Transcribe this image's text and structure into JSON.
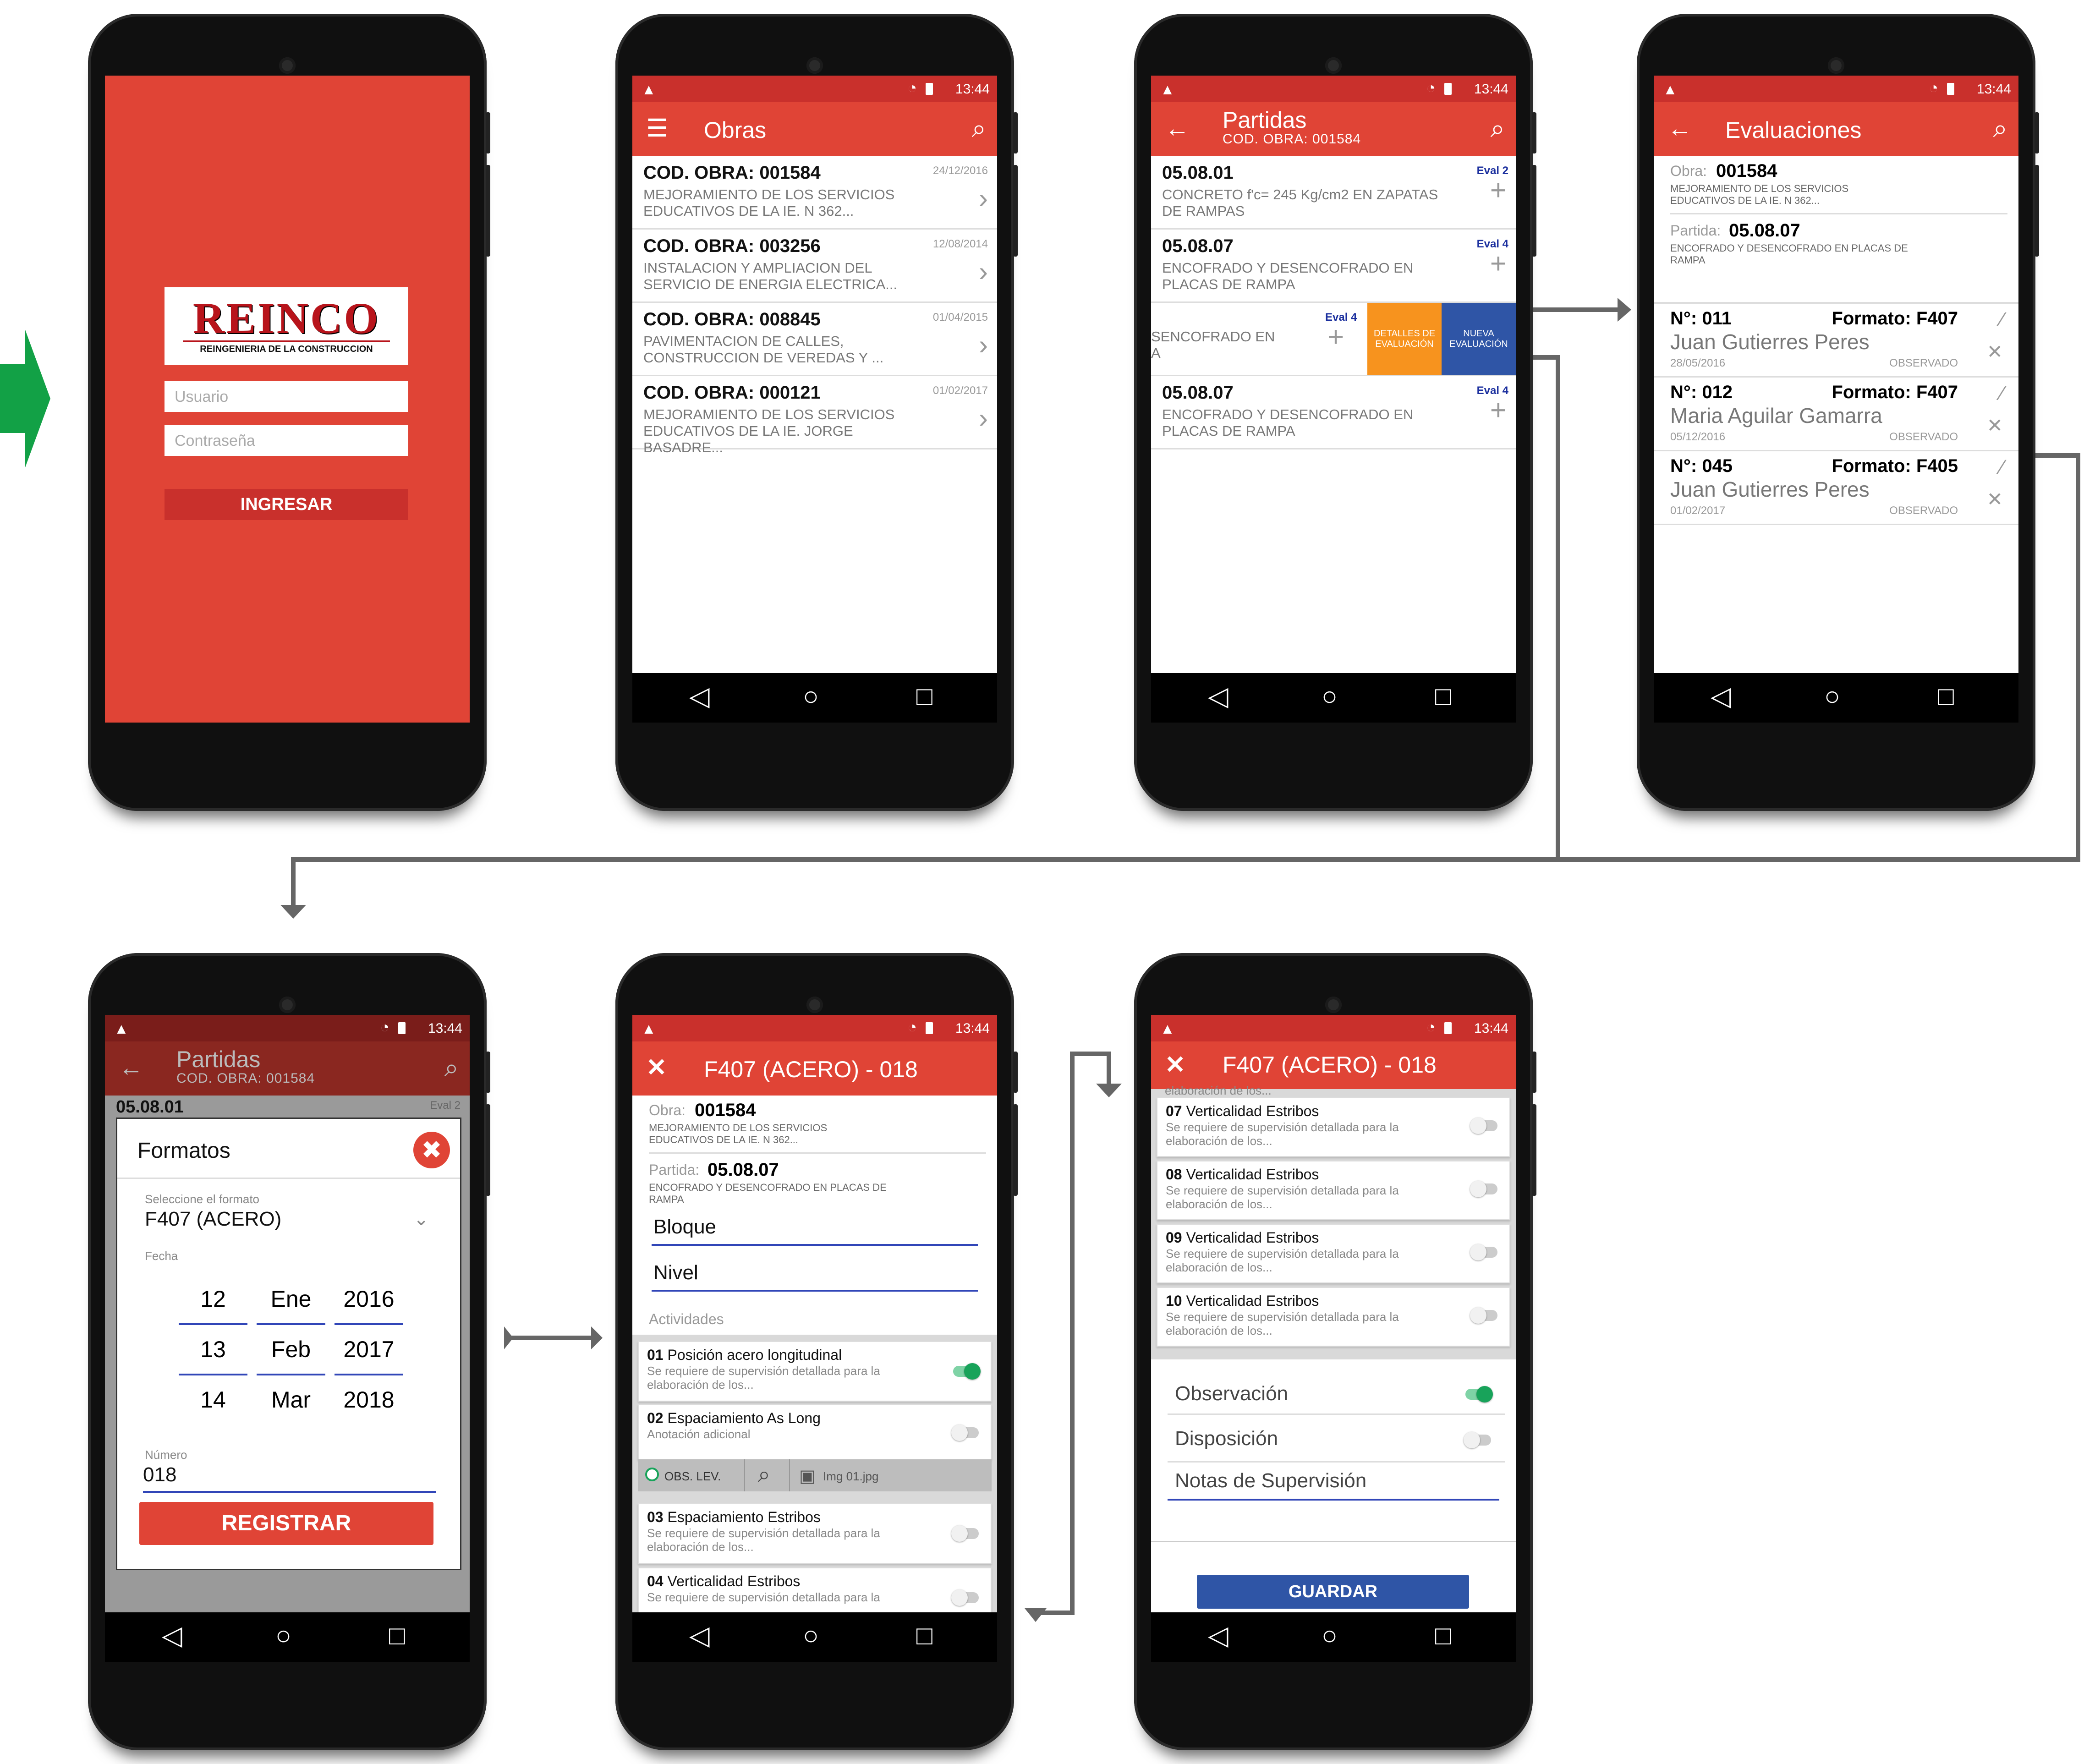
{
  "status": {
    "time": "13:44"
  },
  "login": {
    "logo_text": "REINCO",
    "logo_subtitle": "REINGENIERIA DE LA CONSTRUCCION",
    "user_placeholder": "Usuario",
    "password_placeholder": "Contraseña",
    "button": "INGRESAR"
  },
  "obras": {
    "title": "Obras",
    "items": [
      {
        "code": "COD. OBRA: 001584",
        "desc": "MEJORAMIENTO DE LOS SERVICIOS EDUCATIVOS DE LA IE. N 362...",
        "date": "24/12/2016"
      },
      {
        "code": "COD. OBRA: 003256",
        "desc": "INSTALACION Y AMPLIACION DEL SERVICIO DE ENERGIA ELECTRICA...",
        "date": "12/08/2014"
      },
      {
        "code": "COD. OBRA: 008845",
        "desc": "PAVIMENTACION DE CALLES, CONSTRUCCION DE VEREDAS Y ...",
        "date": "01/04/2015"
      },
      {
        "code": "COD. OBRA: 000121",
        "desc": "MEJORAMIENTO DE LOS SERVICIOS EDUCATIVOS DE LA IE. JORGE BASADRE...",
        "date": "01/02/2017"
      }
    ]
  },
  "partidas": {
    "title": "Partidas",
    "subtitle": "COD. OBRA: 001584",
    "items": [
      {
        "code": "05.08.01",
        "desc": "CONCRETO f'c= 245 Kg/cm2 EN ZAPATAS DE RAMPAS",
        "eval": "Eval 2"
      },
      {
        "code": "05.08.07",
        "desc": "ENCOFRADO Y DESENCOFRADO EN PLACAS DE RAMPA",
        "eval": "Eval 4"
      },
      {
        "code": "05.08.07",
        "desc": "ENCOFRADO Y DESENCOFRADO EN PLACAS DE RAMPA",
        "eval": "Eval 4"
      }
    ],
    "swiped": {
      "desc": "SENCOFRADO EN",
      "desc2": "A",
      "eval": "Eval 4",
      "details": "DETALLES DE EVALUACIÓN",
      "new": "NUEVA EVALUACIÓN"
    }
  },
  "evaluaciones": {
    "title": "Evaluaciones",
    "obra_label": "Obra:",
    "obra_code": "001584",
    "obra_desc": "MEJORAMIENTO DE LOS SERVICIOS EDUCATIVOS DE LA IE. N 362...",
    "partida_label": "Partida:",
    "partida_code": "05.08.07",
    "partida_desc": "ENCOFRADO Y DESENCOFRADO EN PLACAS DE RAMPA",
    "items": [
      {
        "num": "N°: 011",
        "formato": "Formato: F407",
        "name": "Juan Gutierres Peres",
        "date": "28/05/2016",
        "state": "OBSERVADO"
      },
      {
        "num": "N°: 012",
        "formato": "Formato: F407",
        "name": "Maria Aguilar Gamarra",
        "date": "05/12/2016",
        "state": "OBSERVADO"
      },
      {
        "num": "N°: 045",
        "formato": "Formato: F405",
        "name": "Juan Gutierres Peres",
        "date": "01/02/2017",
        "state": "OBSERVADO"
      }
    ]
  },
  "formatos": {
    "bg_title": "Partidas",
    "bg_subtitle": "COD. OBRA: 001584",
    "bg_code": "05.08.01",
    "bg_eval": "Eval 2",
    "title": "Formatos",
    "select_label": "Seleccione el formato",
    "select_value": "F407 (ACERO)",
    "fecha_label": "Fecha",
    "days": [
      "12",
      "13",
      "14"
    ],
    "months": [
      "Ene",
      "Feb",
      "Mar"
    ],
    "years": [
      "2016",
      "2017",
      "2018"
    ],
    "numero_label": "Número",
    "numero_value": "018",
    "button": "REGISTRAR"
  },
  "form1": {
    "title": "F407 (ACERO) - 018",
    "obra_label": "Obra:",
    "obra_code": "001584",
    "obra_desc": "MEJORAMIENTO DE LOS SERVICIOS EDUCATIVOS DE LA IE. N 362...",
    "partida_label": "Partida:",
    "partida_code": "05.08.07",
    "partida_desc": "ENCOFRADO Y DESENCOFRADO EN PLACAS DE RAMPA",
    "bloque": "Bloque",
    "nivel": "Nivel",
    "actividades_label": "Actividades",
    "activities": [
      {
        "num": "01",
        "title": "Posición acero longitudinal",
        "desc": "Se requiere de supervisión detallada para la elaboración de los...",
        "on": true
      },
      {
        "num": "02",
        "title": "Espaciamiento As Long",
        "desc": "Anotación adicional",
        "on": false
      },
      {
        "num": "03",
        "title": "Espaciamiento Estribos",
        "desc": "Se requiere de supervisión detallada para la elaboración de los...",
        "on": false
      },
      {
        "num": "04",
        "title": "Verticalidad Estribos",
        "desc": "Se requiere de supervisión detallada para la",
        "on": false
      }
    ],
    "toolbar": {
      "obs": "OBS. LEV.",
      "img": "Img 01.jpg"
    }
  },
  "form2": {
    "title": "F407 (ACERO) - 018",
    "top_cut": "elaboración de los...",
    "activities": [
      {
        "num": "07",
        "title": "Verticalidad Estribos",
        "desc": "Se requiere de supervisión detallada para la elaboración de los..."
      },
      {
        "num": "08",
        "title": "Verticalidad Estribos",
        "desc": "Se requiere de supervisión detallada para la elaboración de los..."
      },
      {
        "num": "09",
        "title": "Verticalidad Estribos",
        "desc": "Se requiere de supervisión detallada para la elaboración de los..."
      },
      {
        "num": "10",
        "title": "Verticalidad Estribos",
        "desc": "Se requiere de supervisión detallada para la elaboración de los..."
      }
    ],
    "observacion": "Observación",
    "disposicion": "Disposición",
    "notas": "Notas de Supervisión",
    "button": "GUARDAR"
  },
  "colors": {
    "red": "#e04436",
    "dark_red": "#c9302c",
    "blue": "#2f55a6",
    "orange": "#f7931e",
    "green": "#18a35a",
    "flow_arrow": "#12a146"
  }
}
